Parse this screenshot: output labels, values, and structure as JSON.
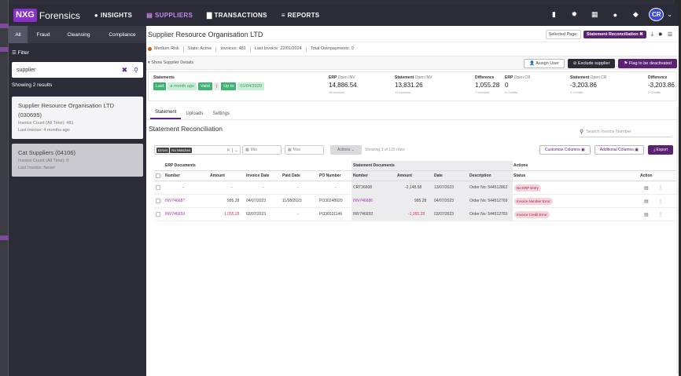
{
  "app": {
    "logo_mark": "NXG",
    "logo_text": "Forensics"
  },
  "topnav": [
    {
      "label": "INSIGHTS",
      "icon": "bulb-icon",
      "glyph": "●",
      "active": false
    },
    {
      "label": "SUPPLIERS",
      "icon": "stack-icon",
      "glyph": "▤",
      "active": true
    },
    {
      "label": "TRANSACTIONS",
      "icon": "doc-icon",
      "glyph": "▇",
      "active": false
    },
    {
      "label": "REPORTS",
      "icon": "bars-icon",
      "glyph": "≡",
      "active": false
    }
  ],
  "topicons": [
    "file-icon",
    "gear-icon",
    "grid-icon",
    "help-icon",
    "chat-icon"
  ],
  "user": {
    "initials": "CR"
  },
  "sidebar": {
    "tabs": [
      "All",
      "Fraud",
      "Cleansing",
      "Compliance"
    ],
    "filter_label": "Filter",
    "search_value": "supplier",
    "result_count": "Showing 2 results",
    "cards": [
      {
        "name": "Supplier Resource Organisation LTD (030695)",
        "invoice_count": "Invoice Count (All Time): 481",
        "last_invoice": "Last Invoice: 4 months ago"
      },
      {
        "name": "Cat Suppliers (04106)",
        "invoice_count": "Invoice Count (All Time): 0",
        "last_invoice": "Last Invoice: Never"
      }
    ]
  },
  "supplier": {
    "title": "Supplier Resource Organisation LTD",
    "selected_page_label": "Selected Page:",
    "selected_page": "Statement Reconciliation",
    "risk": "Medium Risk",
    "state": "State: Active",
    "invoices": "Invoices: 481",
    "last_invoice": "Last Invoice: 22/01/2024",
    "overpayments": "Total Overpayments: 0",
    "show_details": "Show Supplier Details",
    "buttons": {
      "assign": "Assign User",
      "exclude": "Exclude supplier",
      "flag": "Flag to be deactivated"
    }
  },
  "stats": {
    "statements": {
      "title": "Statements",
      "chips": [
        "Last",
        "a month ago",
        "Valid",
        "Up to",
        "01/04/2020"
      ]
    },
    "erp_open_inv": {
      "title": "ERP",
      "sub": "Open INV",
      "value": "14,886.54",
      "small": "18 Invoices"
    },
    "stmt_open_inv": {
      "title": "Statement",
      "sub": "Open INV",
      "value": "13,831.26",
      "small": "11 Invoices"
    },
    "difference1": {
      "title": "Difference",
      "value": "1,055.28",
      "small": "7 Invoices"
    },
    "erp_open_cr": {
      "title": "ERP",
      "sub": "Open CR",
      "value": "0",
      "small": "0 Credits"
    },
    "stmt_open_cr": {
      "title": "Statement",
      "sub": "Open CR",
      "value": "-3,203.86",
      "small": "2 Credits"
    },
    "difference2": {
      "title": "Difference",
      "value": "-3,203.86",
      "small": "2 Credits"
    }
  },
  "subtabs": [
    "Statement",
    "Uploads",
    "Settings"
  ],
  "reconciliation": {
    "title": "Statement Reconciliation",
    "search_placeholder": "Search Invoice Number",
    "filter_tags": [
      "Errors",
      "No Matches"
    ],
    "min_placeholder": "Min",
    "max_placeholder": "Max",
    "actions_label": "Actions",
    "showing": "Showing 3 of 135 rows",
    "customise": "Customise Columns",
    "additional": "Additional Columns",
    "export": "Export"
  },
  "table": {
    "groups": {
      "erp": "ERP Documents",
      "stmt": "Statement Documents",
      "actions": "Actions"
    },
    "columns": [
      "Number",
      "Amount",
      "Invoice Date",
      "Paid Date",
      "PO Number",
      "Number",
      "Amount",
      "Date",
      "Description",
      "Status",
      "Action"
    ],
    "rows": [
      {
        "erp_number": "-",
        "erp_amount": "-",
        "invoice_date": "-",
        "paid_date": "-",
        "po_number": "-",
        "stmt_number": "CRT36608",
        "stmt_amount": "-2,148.58",
        "date": "13/07/2023",
        "description": "Order No: 544512862",
        "status": "No ERP Entry"
      },
      {
        "erp_number": "INV746687",
        "erp_amount": "995.28",
        "invoice_date": "04/07/2023",
        "paid_date": "11/08/2023",
        "po_number": "PO30248020",
        "stmt_number": "INV746686",
        "stmt_amount": "995.28",
        "date": "04/07/2023",
        "description": "Order No: 544512769",
        "status": "Invoice Number Error"
      },
      {
        "erp_number": "INV746659",
        "erp_amount": "1,055.28",
        "invoice_date": "03/07/2023",
        "paid_date": "-",
        "po_number": "PO30331146",
        "stmt_number": "INV746659",
        "stmt_amount": "-1,055.28",
        "date": "03/07/2023",
        "description": "Order No: 544512760",
        "status": "Invoice Credit Error"
      }
    ]
  },
  "colors": {
    "brand": "#8b2fc9",
    "dark": "#2c2c38",
    "accent": "#5b2172",
    "badge": "#f3d4dc",
    "risk": "#c25a13"
  }
}
